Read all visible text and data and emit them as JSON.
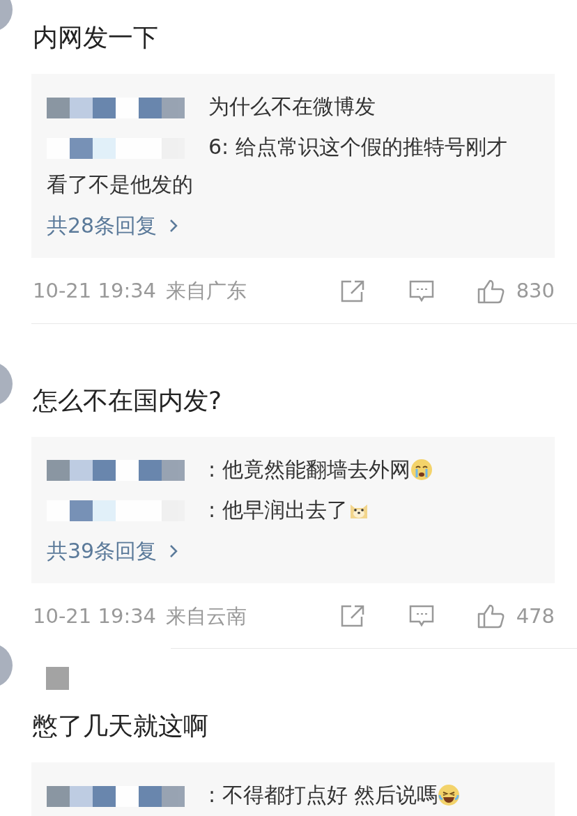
{
  "comments": [
    {
      "text": "内网发一下",
      "replies": [
        {
          "name_hidden": true,
          "text": "为什么不在微博发",
          "kind": "plain"
        },
        {
          "name_hidden": true,
          "text": "6: 给点常识这个假的推特号刚才看了不是他发的",
          "kind": "plain"
        }
      ],
      "more": "共28条回复",
      "footer": {
        "time": "10-21 19:34",
        "location": "来自广东",
        "likes": "830"
      }
    },
    {
      "text": "怎么不在国内发?",
      "replies": [
        {
          "name_hidden": true,
          "text": ": 他竟然能翻墙去外网",
          "kind": "crying"
        },
        {
          "name_hidden": true,
          "text": ": 他早润出去了",
          "kind": "dog"
        }
      ],
      "more": "共39条回复",
      "footer": {
        "time": "10-21 19:34",
        "location": "来自云南",
        "likes": "478"
      }
    },
    {
      "name_hidden": true,
      "text": "憋了几天就这啊",
      "replies": [
        {
          "name_hidden": true,
          "text": ": 不得都打点好 然后说嗎",
          "kind": "laughing"
        }
      ]
    }
  ]
}
